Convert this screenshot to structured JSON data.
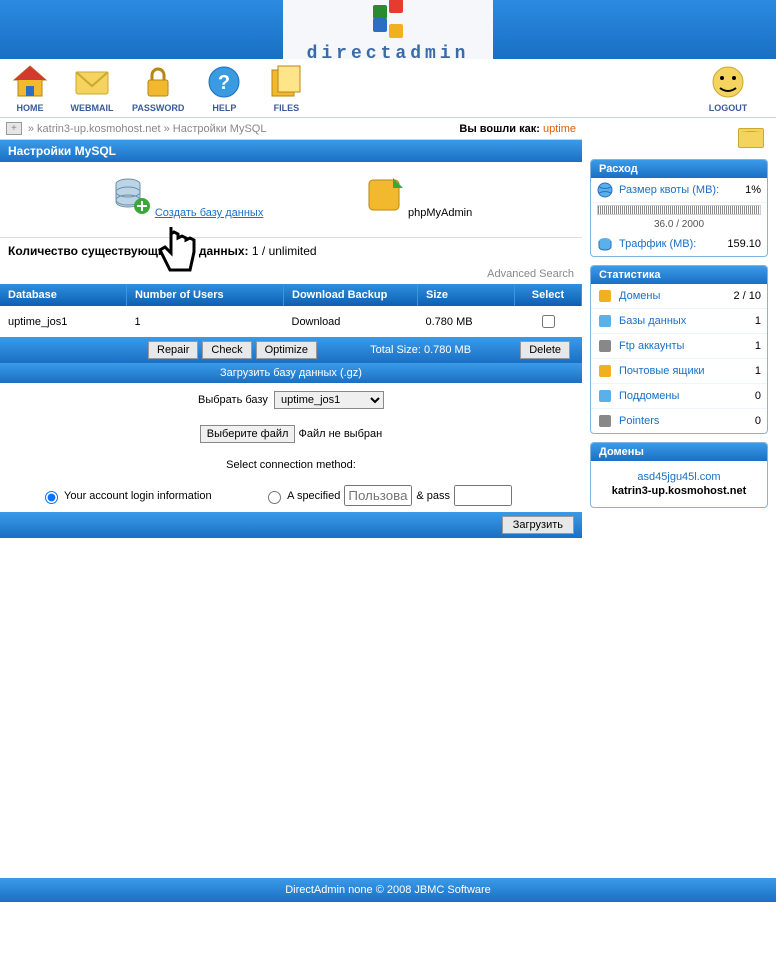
{
  "logo_text": "directadmin",
  "nav": {
    "home": "HOME",
    "webmail": "WEBMAIL",
    "password": "PASSWORD",
    "help": "HELP",
    "files": "FILES",
    "logout": "LOGOUT"
  },
  "breadcrumb": {
    "host": "katrin3-up.kosmohost.net",
    "page": "Настройки MySQL",
    "sep": "»",
    "logged_in_as_label": "Вы вошли как:",
    "user": "uptime"
  },
  "panel_title": "Настройки MySQL",
  "icons": {
    "create_db": "Создать базу данных",
    "phpmyadmin": "phpMyAdmin"
  },
  "db_count_label": "Количество существующих баз данных:",
  "db_count_value": "1 / unlimited",
  "advanced_search": "Advanced Search",
  "table": {
    "headers": {
      "database": "Database",
      "users": "Number of Users",
      "download": "Download Backup",
      "size": "Size",
      "select": "Select"
    },
    "rows": [
      {
        "name": "uptime_jos1",
        "users": "1",
        "download": "Download",
        "size": "0.780 MB"
      }
    ]
  },
  "actions": {
    "repair": "Repair",
    "check": "Check",
    "optimize": "Optimize",
    "total_size_label": "Total Size: 0.780 MB",
    "delete": "Delete"
  },
  "upload": {
    "header": "Загрузить базу данных (.gz)",
    "select_db_label": "Выбрать базу",
    "db_options": [
      "uptime_jos1"
    ],
    "choose_file_btn": "Выберите файл",
    "no_file": "Файл не выбран",
    "conn_method_label": "Select connection method:",
    "opt_account": "Your account login information",
    "opt_specified": "A specified",
    "user_placeholder": "Пользова",
    "pass_label": "& pass",
    "submit": "Загрузить"
  },
  "sidebar": {
    "usage_title": "Расход",
    "quota_label": "Размер квоты (MB):",
    "quota_pct": "1%",
    "quota_text": "36.0 / 2000",
    "traffic_label": "Траффик (MB):",
    "traffic_val": "159.10",
    "stats_title": "Статистика",
    "stats": [
      {
        "label": "Домены",
        "val": "2 / 10"
      },
      {
        "label": "Базы данных",
        "val": "1"
      },
      {
        "label": "Ftp аккаунты",
        "val": "1"
      },
      {
        "label": "Почтовые ящики",
        "val": "1"
      },
      {
        "label": "Поддомены",
        "val": "0"
      },
      {
        "label": "Pointers",
        "val": "0"
      }
    ],
    "domains_title": "Домены",
    "domains": [
      {
        "name": "asd45jgu45l.com",
        "current": false
      },
      {
        "name": "katrin3-up.kosmohost.net",
        "current": true
      }
    ]
  },
  "footer": "DirectAdmin none © 2008 JBMC Software"
}
